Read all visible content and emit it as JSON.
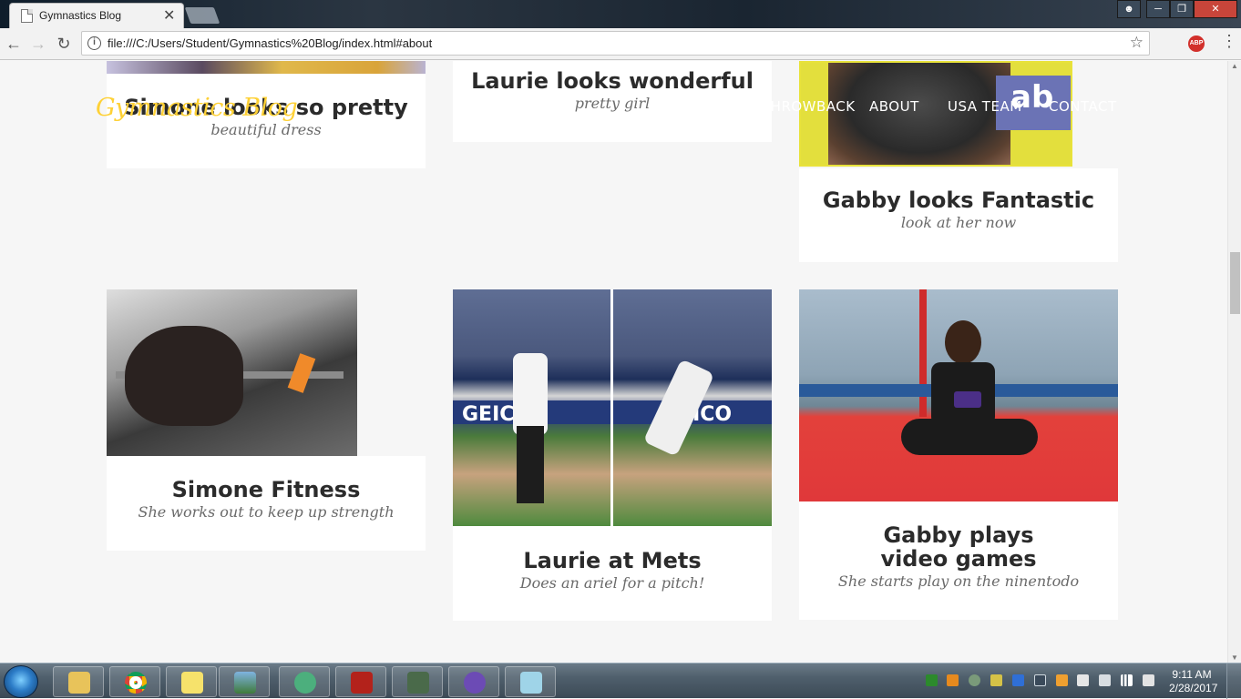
{
  "browser": {
    "tab_title": "Gymnastics Blog",
    "tab_close": "✕",
    "url": "file:///C:/Users/Student/Gymnastics%20Blog/index.html#about",
    "abp_label": "ABP"
  },
  "site": {
    "brand": "Gymnastics Blog",
    "nav": [
      "THROWBACK",
      "ABOUT",
      "USA TEAM",
      "CONTACT"
    ]
  },
  "posts": [
    {
      "title": "Simone looks so pretty",
      "subtitle": "beautiful dress"
    },
    {
      "title": "Laurie looks wonderful",
      "subtitle": "pretty girl"
    },
    {
      "title": "Gabby looks Fantastic",
      "subtitle": "look at her now"
    },
    {
      "title": "Simone Fitness",
      "subtitle": "She works out to keep up strength"
    },
    {
      "title": "Laurie at Mets",
      "subtitle": "Does an ariel for a pitch!"
    },
    {
      "title": "Gabby plays video games",
      "subtitle": "She starts play on the ninentodo"
    }
  ],
  "taskbar": {
    "time": "9:11 AM",
    "date": "2/28/2017"
  },
  "colors": {
    "brand": "#fed136",
    "page_bg": "#f6f6f6",
    "card_bg": "#ffffff"
  }
}
